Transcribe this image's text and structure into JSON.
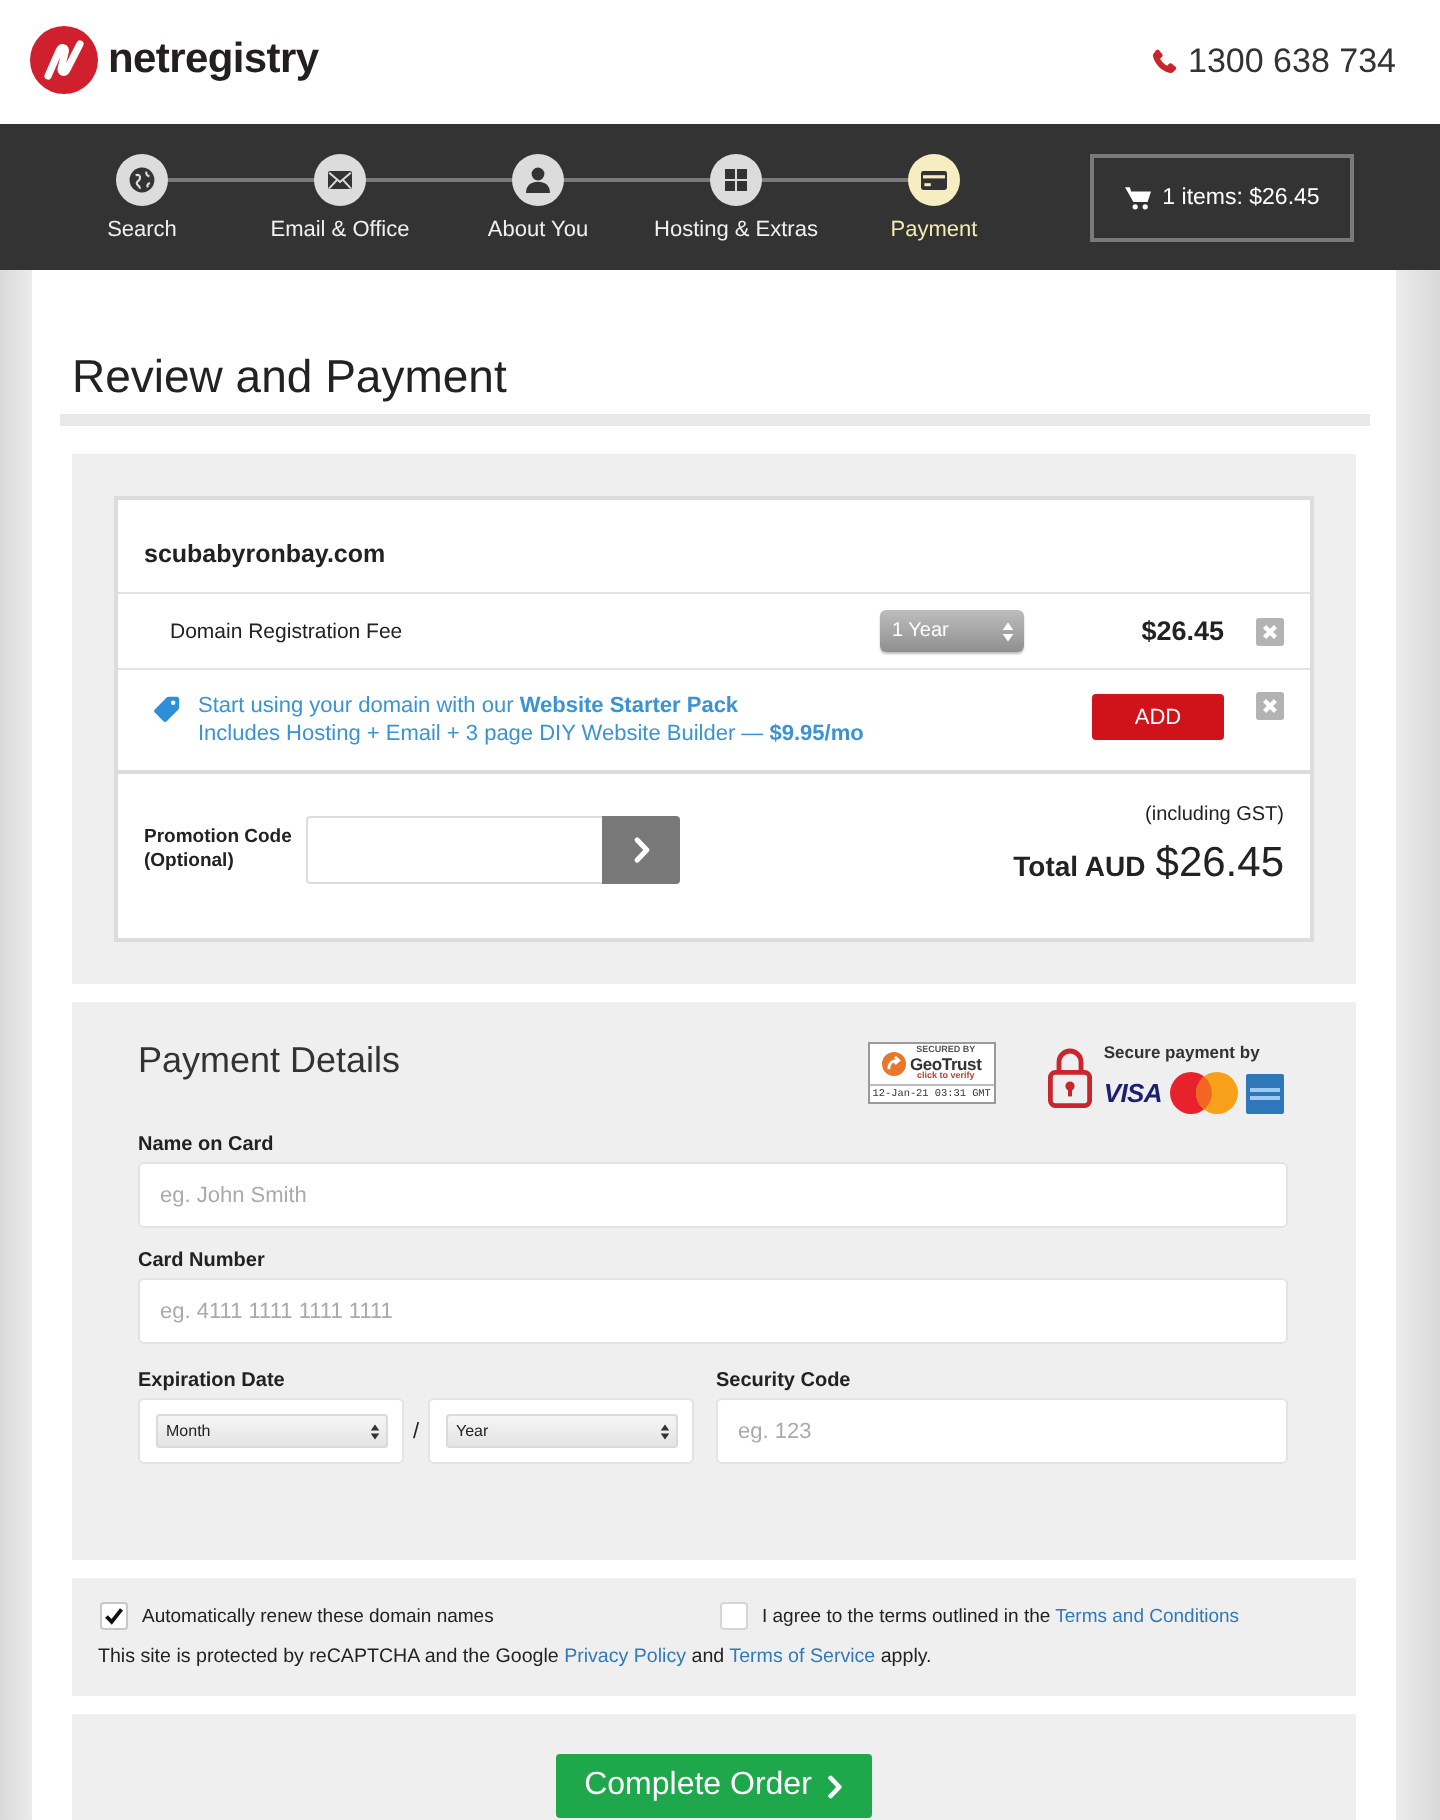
{
  "header": {
    "logo_text": "netregistry",
    "phone": "1300 638 734"
  },
  "steps": [
    {
      "label": "Search",
      "selected": false
    },
    {
      "label": "Email & Office",
      "selected": false
    },
    {
      "label": "About You",
      "selected": false
    },
    {
      "label": "Hosting & Extras",
      "selected": false
    },
    {
      "label": "Payment",
      "selected": true
    }
  ],
  "cart": {
    "summary": "1 items: $26.45"
  },
  "page_title": "Review and Payment",
  "order": {
    "domain": "scubabyronbay.com",
    "lines": [
      {
        "kind": "fee",
        "label": "Domain Registration Fee",
        "period": "1 Year",
        "price": "$26.45"
      },
      {
        "kind": "offer",
        "text": "Start using your domain with our **Website Starter Pack**",
        "detail": "Includes Hosting + Email + 3 page DIY Website Builder — **$9.95/mo**",
        "action": "ADD"
      }
    ],
    "promo": {
      "label": "Promotion Code (Optional)"
    },
    "tax_note": "(including GST)",
    "total_label": "Total AUD",
    "total": "$26.45"
  },
  "payment": {
    "title": "Payment Details",
    "seal": {
      "caption": "SECURED BY",
      "brand": "GeoTrust",
      "action": "click to verify",
      "stamp": "12-Jan-21 03:31 GMT"
    },
    "secure_label": "Secure payment by",
    "card_brand": "VISA",
    "fields": [
      {
        "label": "Name on Card",
        "placeholder": "eg. John Smith"
      },
      {
        "label": "Card Number",
        "placeholder": "eg. 4111 1111 1111 1111"
      }
    ],
    "expiry": {
      "label": "Expiration Date",
      "month": "Month",
      "separator": "/",
      "year": "Year"
    },
    "security": {
      "label": "Security Code",
      "placeholder": "eg. 123"
    }
  },
  "agreements": [
    {
      "text": "Automatically renew these domain names",
      "checked": true
    },
    {
      "text": "I agree to the terms outlined in the ",
      "link": "Terms and Conditions",
      "checked": false
    }
  ],
  "notice": [
    {
      "kind": "text",
      "text": "This site is protected by reCAPTCHA and the Google "
    },
    {
      "kind": "link",
      "text": "Privacy Policy"
    },
    {
      "kind": "text",
      "text": " and "
    },
    {
      "kind": "link",
      "text": "Terms of Service"
    },
    {
      "kind": "text",
      "text": " apply."
    }
  ],
  "submit": {
    "label": "Complete Order"
  }
}
